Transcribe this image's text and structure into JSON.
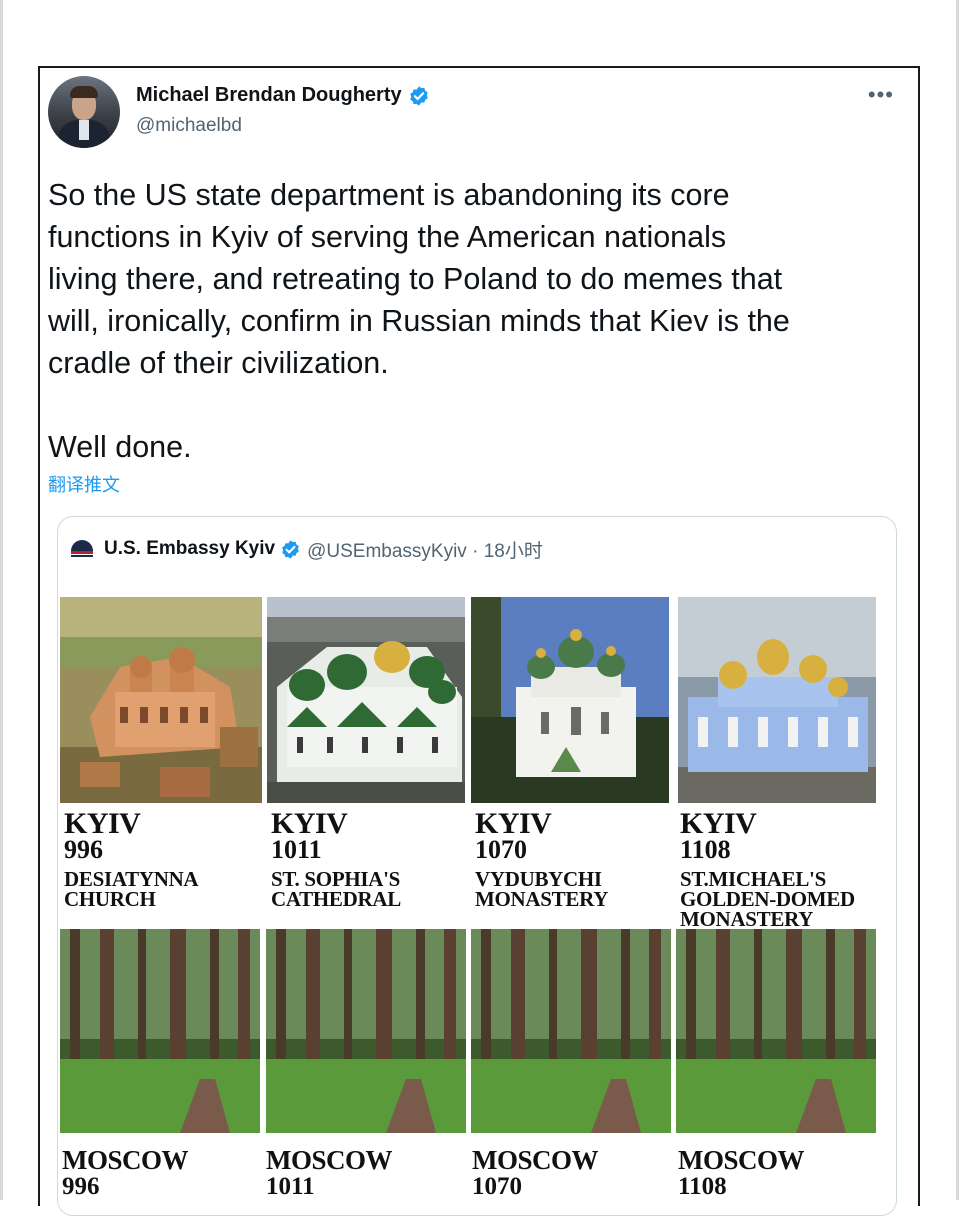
{
  "author": {
    "name": "Michael Brendan Dougherty",
    "handle": "@michaelbd"
  },
  "more_label": "•••",
  "tweet": {
    "lines": [
      "So the US state department is abandoning its core",
      "functions in Kyiv of serving the American nationals",
      "living there, and retreating to Poland to do memes that",
      "will, ironically, confirm in Russian minds that Kiev is the",
      "cradle of their civilization."
    ],
    "closing": "Well done.",
    "translate_label": "翻译推文"
  },
  "quote": {
    "name": "U.S. Embassy Kyiv",
    "handle_time": "@USEmbassyKyiv · 18小时",
    "kyiv_panels": [
      {
        "city": "KYIV",
        "year": "996",
        "place1": "DESIATYNNA",
        "place2": "CHURCH",
        "place3": ""
      },
      {
        "city": "KYIV",
        "year": "1011",
        "place1": "ST. SOPHIA'S",
        "place2": "CATHEDRAL",
        "place3": ""
      },
      {
        "city": "KYIV",
        "year": "1070",
        "place1": "VYDUBYCHI",
        "place2": "MONASTERY",
        "place3": ""
      },
      {
        "city": "KYIV",
        "year": "1108",
        "place1": "ST.MICHAEL'S",
        "place2": "GOLDEN-DOMED",
        "place3": "MONASTERY"
      }
    ],
    "moscow_panels": [
      {
        "city": "MOSCOW",
        "year": "996"
      },
      {
        "city": "MOSCOW",
        "year": "1011"
      },
      {
        "city": "MOSCOW",
        "year": "1070"
      },
      {
        "city": "MOSCOW",
        "year": "1108"
      }
    ]
  },
  "colors": {
    "accent": "#1d9bf0",
    "text": "#0f1419",
    "muted": "#536471"
  }
}
